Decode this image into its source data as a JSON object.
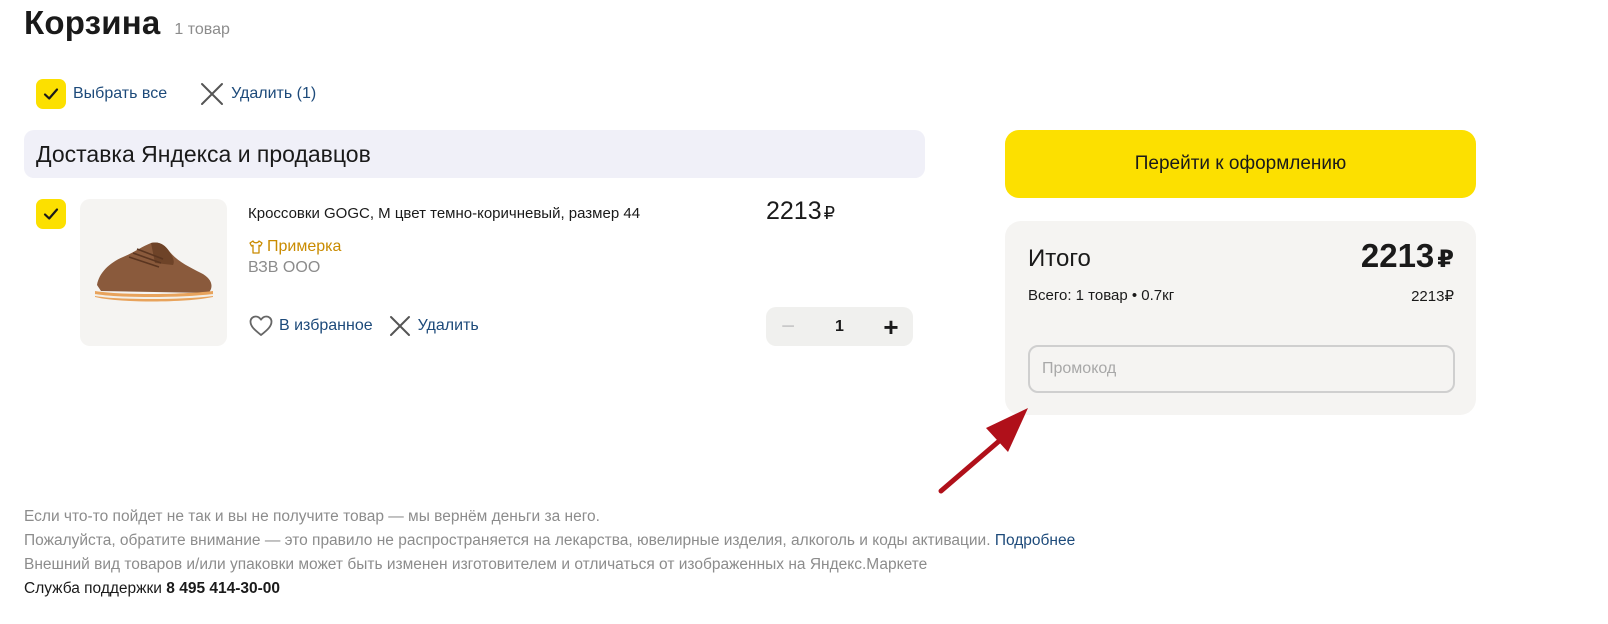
{
  "header": {
    "title": "Корзина",
    "count": "1 товар"
  },
  "toolbar": {
    "select_all": "Выбрать все",
    "delete_selected": "Удалить (1)"
  },
  "group": {
    "title": "Доставка Яндекса и продавцов"
  },
  "item": {
    "name": "Кроссовки GOGC, M цвет темно-коричневый, размер 44",
    "fitting": "Примерка",
    "seller": "ВЗВ ООО",
    "favorite": "В избранное",
    "delete": "Удалить",
    "price": "2213",
    "currency": "₽",
    "quantity": "1",
    "minus": "−",
    "plus": "+"
  },
  "checkout": {
    "button": "Перейти к оформлению"
  },
  "summary": {
    "title": "Итого",
    "total": "2213",
    "currency": "₽",
    "subtotal_label": "Всего: 1 товар • 0.7кг",
    "subtotal_price": "2213₽",
    "promo_placeholder": "Промокод"
  },
  "footer": {
    "line1": "Если что-то пойдет не так и вы не получите товар — мы вернём деньги за него.",
    "line2": "Пожалуйста, обратите внимание — это правило не распространяется на лекарства, ювелирные изделия, алкоголь и коды активации.",
    "line2_link": "Подробнее",
    "line3": "Внешний вид товаров и/или упаковки может быть изменен изготовителем и отличаться от изображенных на Яндекс.Маркете",
    "support_label": "Служба поддержки",
    "support_phone": "8 495 414-30-00"
  },
  "colors": {
    "accent": "#fce000",
    "link": "#1d4a7a",
    "fitting": "#c98b00",
    "annotation_arrow": "#b0101a"
  }
}
